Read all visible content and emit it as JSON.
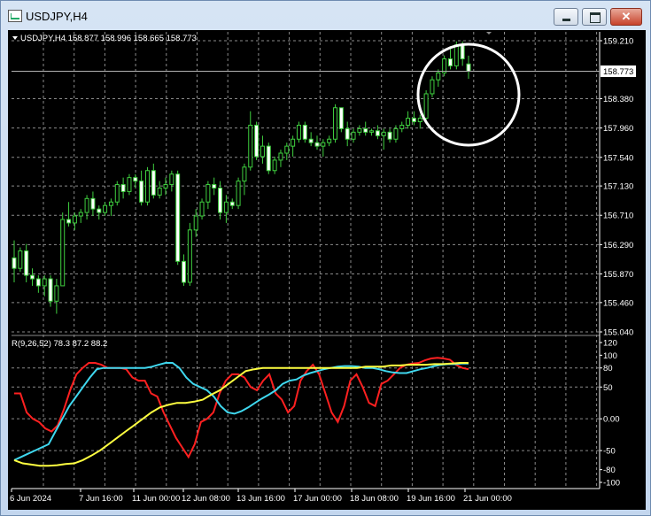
{
  "window": {
    "title": "USDJPY,H4",
    "minimize_label": "",
    "maximize_label": "",
    "close_label": "✕"
  },
  "main_chart": {
    "info_text": "USDJPY,H4  158.877 158.996 158.665 158.773",
    "current_price": "158.773",
    "price_ticks": [
      "159.210",
      "158.380",
      "157.960",
      "157.540",
      "157.130",
      "156.710",
      "156.290",
      "155.870",
      "155.460",
      "155.040"
    ],
    "price_tick_values": [
      159.21,
      158.38,
      157.96,
      157.54,
      157.13,
      156.71,
      156.29,
      155.87,
      155.46,
      155.04
    ]
  },
  "indicator": {
    "info_text": "R(9,26,52) 78.3 87.2 88.2",
    "ticks": [
      "120",
      "100",
      "80",
      "50",
      "0.00",
      "-50",
      "-80",
      "-100"
    ],
    "tick_values": [
      120,
      100,
      80,
      50,
      0,
      -50,
      -80,
      -100
    ]
  },
  "time_axis": {
    "labels": [
      "6 Jun 2024",
      "7 Jun 16:00",
      "11 Jun 00:00",
      "12 Jun 08:00",
      "13 Jun 16:00",
      "17 Jun 00:00",
      "18 Jun 08:00",
      "19 Jun 16:00",
      "21 Jun 00:00"
    ]
  },
  "annotation": {
    "type": "circle",
    "color": "#ffffff"
  },
  "colors": {
    "background": "#000000",
    "grid": "#8a8a8a",
    "candle_up_fill": "#000000",
    "candle_down_fill": "#ffffff",
    "candle_outline": "#3fcf3f",
    "red_line": "#ff2020",
    "cyan_line": "#3fd8ef",
    "yellow_line": "#ffff40"
  },
  "chart_data": {
    "type": "candlestick",
    "symbol": "USDJPY",
    "timeframe": "H4",
    "ylim": [
      155.04,
      159.21
    ],
    "candles": [
      [
        156.1,
        156.35,
        155.75,
        155.95
      ],
      [
        155.95,
        156.25,
        155.9,
        156.2
      ],
      [
        156.2,
        156.3,
        155.75,
        155.85
      ],
      [
        155.85,
        155.95,
        155.7,
        155.8
      ],
      [
        155.8,
        155.85,
        155.6,
        155.7
      ],
      [
        155.7,
        155.85,
        155.55,
        155.8
      ],
      [
        155.8,
        155.85,
        155.4,
        155.48
      ],
      [
        155.48,
        155.8,
        155.3,
        155.7
      ],
      [
        155.7,
        156.75,
        155.7,
        156.65
      ],
      [
        156.65,
        156.9,
        156.55,
        156.6
      ],
      [
        156.6,
        156.75,
        156.5,
        156.7
      ],
      [
        156.7,
        156.8,
        156.6,
        156.75
      ],
      [
        156.75,
        157.0,
        156.65,
        156.95
      ],
      [
        156.95,
        157.05,
        156.7,
        156.8
      ],
      [
        156.8,
        156.85,
        156.65,
        156.75
      ],
      [
        156.75,
        156.9,
        156.7,
        156.85
      ],
      [
        156.85,
        156.95,
        156.7,
        156.9
      ],
      [
        156.9,
        157.2,
        156.85,
        157.15
      ],
      [
        157.15,
        157.25,
        156.95,
        157.05
      ],
      [
        157.05,
        157.3,
        157.0,
        157.25
      ],
      [
        157.25,
        157.3,
        157.1,
        157.2
      ],
      [
        157.2,
        157.35,
        156.85,
        156.9
      ],
      [
        156.9,
        157.4,
        156.85,
        157.35
      ],
      [
        157.35,
        157.45,
        156.95,
        157.0
      ],
      [
        157.0,
        157.2,
        156.95,
        157.1
      ],
      [
        157.1,
        157.25,
        157.0,
        157.15
      ],
      [
        157.15,
        157.35,
        157.05,
        157.3
      ],
      [
        157.3,
        157.35,
        156.0,
        156.05
      ],
      [
        156.05,
        156.15,
        155.7,
        155.75
      ],
      [
        155.75,
        156.6,
        155.7,
        156.5
      ],
      [
        156.5,
        156.8,
        156.4,
        156.7
      ],
      [
        156.7,
        156.95,
        156.65,
        156.9
      ],
      [
        156.9,
        157.2,
        156.8,
        157.15
      ],
      [
        157.15,
        157.25,
        157.0,
        157.1
      ],
      [
        157.1,
        157.2,
        156.65,
        156.75
      ],
      [
        156.75,
        157.0,
        156.6,
        156.9
      ],
      [
        156.9,
        156.95,
        156.8,
        156.85
      ],
      [
        156.85,
        157.25,
        156.8,
        157.2
      ],
      [
        157.2,
        157.45,
        157.0,
        157.4
      ],
      [
        157.4,
        158.2,
        157.35,
        158.0
      ],
      [
        158.0,
        158.05,
        157.5,
        157.55
      ],
      [
        157.55,
        157.85,
        157.45,
        157.7
      ],
      [
        157.7,
        157.75,
        157.3,
        157.35
      ],
      [
        157.35,
        157.55,
        157.3,
        157.5
      ],
      [
        157.5,
        157.65,
        157.4,
        157.6
      ],
      [
        157.6,
        157.75,
        157.5,
        157.7
      ],
      [
        157.7,
        157.85,
        157.55,
        157.8
      ],
      [
        157.8,
        158.05,
        157.75,
        158.0
      ],
      [
        158.0,
        158.05,
        157.75,
        157.8
      ],
      [
        157.8,
        157.9,
        157.7,
        157.75
      ],
      [
        157.75,
        157.85,
        157.65,
        157.7
      ],
      [
        157.7,
        157.8,
        157.55,
        157.75
      ],
      [
        157.75,
        157.85,
        157.7,
        157.8
      ],
      [
        157.8,
        158.3,
        157.75,
        158.25
      ],
      [
        158.25,
        158.25,
        157.9,
        157.95
      ],
      [
        157.95,
        158.05,
        157.7,
        157.8
      ],
      [
        157.8,
        157.95,
        157.75,
        157.9
      ],
      [
        157.9,
        158.0,
        157.85,
        157.95
      ],
      [
        157.95,
        158.05,
        157.85,
        157.9
      ],
      [
        157.9,
        157.95,
        157.85,
        157.92
      ],
      [
        157.92,
        158.0,
        157.8,
        157.85
      ],
      [
        157.85,
        157.95,
        157.65,
        157.9
      ],
      [
        157.9,
        157.95,
        157.75,
        157.8
      ],
      [
        157.8,
        158.0,
        157.75,
        157.95
      ],
      [
        157.95,
        158.05,
        157.9,
        158.0
      ],
      [
        158.0,
        158.2,
        157.95,
        158.1
      ],
      [
        158.1,
        158.2,
        158.0,
        158.05
      ],
      [
        158.05,
        158.15,
        157.95,
        158.1
      ],
      [
        158.1,
        158.5,
        158.05,
        158.45
      ],
      [
        158.45,
        158.7,
        158.4,
        158.65
      ],
      [
        158.65,
        158.8,
        158.55,
        158.75
      ],
      [
        158.75,
        159.0,
        158.7,
        158.95
      ],
      [
        158.95,
        159.1,
        158.8,
        158.85
      ],
      [
        158.85,
        159.2,
        158.8,
        159.15
      ],
      [
        159.15,
        159.2,
        158.85,
        158.95
      ],
      [
        158.877,
        158.996,
        158.665,
        158.773
      ]
    ],
    "indicator": {
      "ylim": [
        -100,
        120
      ],
      "series": [
        {
          "color": "#ff2020",
          "values": [
            40,
            40,
            10,
            0,
            -5,
            -15,
            -20,
            -10,
            15,
            45,
            70,
            80,
            88,
            88,
            85,
            80,
            80,
            80,
            78,
            65,
            60,
            60,
            40,
            35,
            10,
            -10,
            -30,
            -45,
            -60,
            -40,
            -5,
            0,
            10,
            40,
            60,
            70,
            70,
            65,
            50,
            45,
            60,
            70,
            40,
            30,
            10,
            20,
            60,
            75,
            85,
            70,
            40,
            10,
            -5,
            20,
            60,
            70,
            50,
            25,
            20,
            55,
            60,
            70,
            80,
            85,
            87,
            88,
            92,
            95,
            96,
            95,
            93,
            85,
            80,
            78
          ]
        },
        {
          "color": "#3fd8ef",
          "values": [
            -65,
            -60,
            -55,
            -50,
            -45,
            -40,
            -20,
            0,
            20,
            35,
            50,
            65,
            78,
            80,
            80,
            80,
            80,
            80,
            80,
            80,
            82,
            85,
            88,
            88,
            80,
            65,
            55,
            50,
            45,
            35,
            20,
            10,
            8,
            12,
            18,
            25,
            32,
            38,
            45,
            55,
            60,
            62,
            68,
            72,
            75,
            78,
            80,
            82,
            83,
            83,
            82,
            80,
            80,
            78,
            75,
            73,
            72,
            72,
            75,
            78,
            80,
            83,
            85,
            86,
            86,
            87,
            87
          ]
        },
        {
          "color": "#ffff40",
          "values": [
            -65,
            -70,
            -72,
            -74,
            -74,
            -73,
            -71,
            -70,
            -65,
            -58,
            -50,
            -40,
            -30,
            -20,
            -10,
            0,
            10,
            18,
            22,
            25,
            25,
            27,
            30,
            38,
            45,
            55,
            65,
            75,
            78,
            80,
            80,
            80,
            80,
            80,
            80,
            80,
            80,
            80,
            80,
            80,
            80,
            82,
            82,
            82,
            84,
            84,
            85,
            85,
            85,
            86,
            86,
            87,
            88,
            88
          ]
        }
      ]
    }
  }
}
